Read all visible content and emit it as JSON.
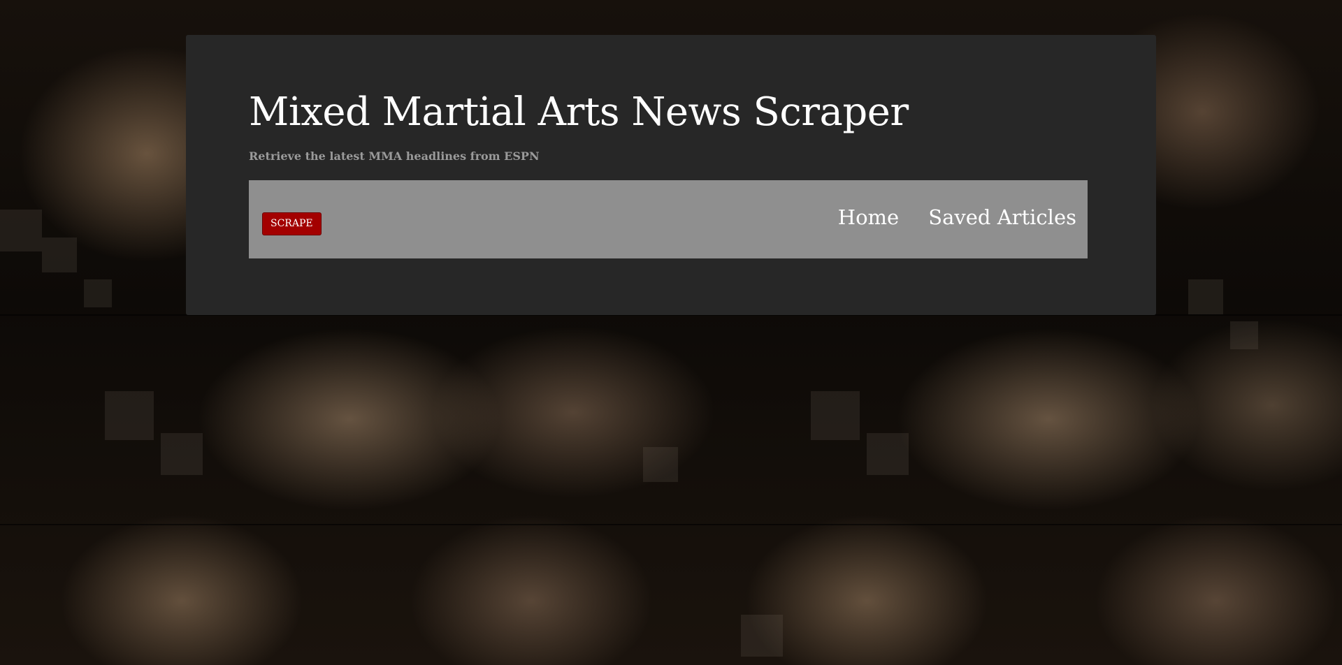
{
  "header": {
    "title": "Mixed Martial Arts News Scraper",
    "subtitle": "Retrieve the latest MMA headlines from ESPN"
  },
  "navbar": {
    "scrape_label": "SCRAPE",
    "links": [
      {
        "label": "Home"
      },
      {
        "label": "Saved Articles"
      }
    ]
  },
  "colors": {
    "panel": "#272727",
    "navbar": "#8f8f8f",
    "scrape_button": "#a30000",
    "title_text": "#ffffff",
    "subtitle_text": "#9a9a9a"
  }
}
